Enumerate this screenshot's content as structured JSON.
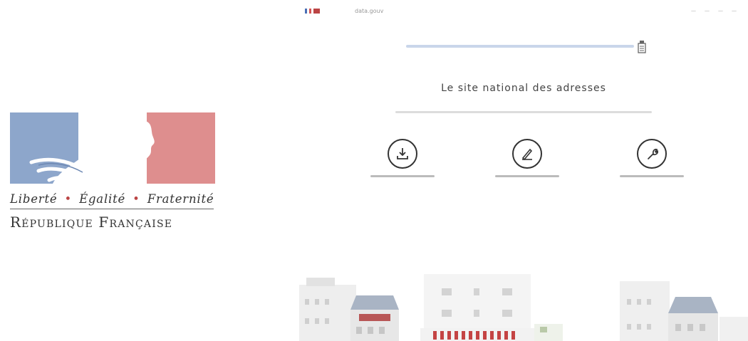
{
  "logo": {
    "motto": {
      "liberte": "Liberté",
      "egalite": "Égalité",
      "fraternite": "Fraternité",
      "separator": "•"
    },
    "republic": "République Française",
    "colors": {
      "blue": "#7f9bc4",
      "red": "#d98a8a"
    }
  },
  "site": {
    "topbar": {
      "breadcrumb": "data.gouv"
    },
    "title": "Le site national des adresses",
    "actions": [
      {
        "icon": "download-icon"
      },
      {
        "icon": "pencil-icon"
      },
      {
        "icon": "wrench-icon"
      }
    ]
  }
}
